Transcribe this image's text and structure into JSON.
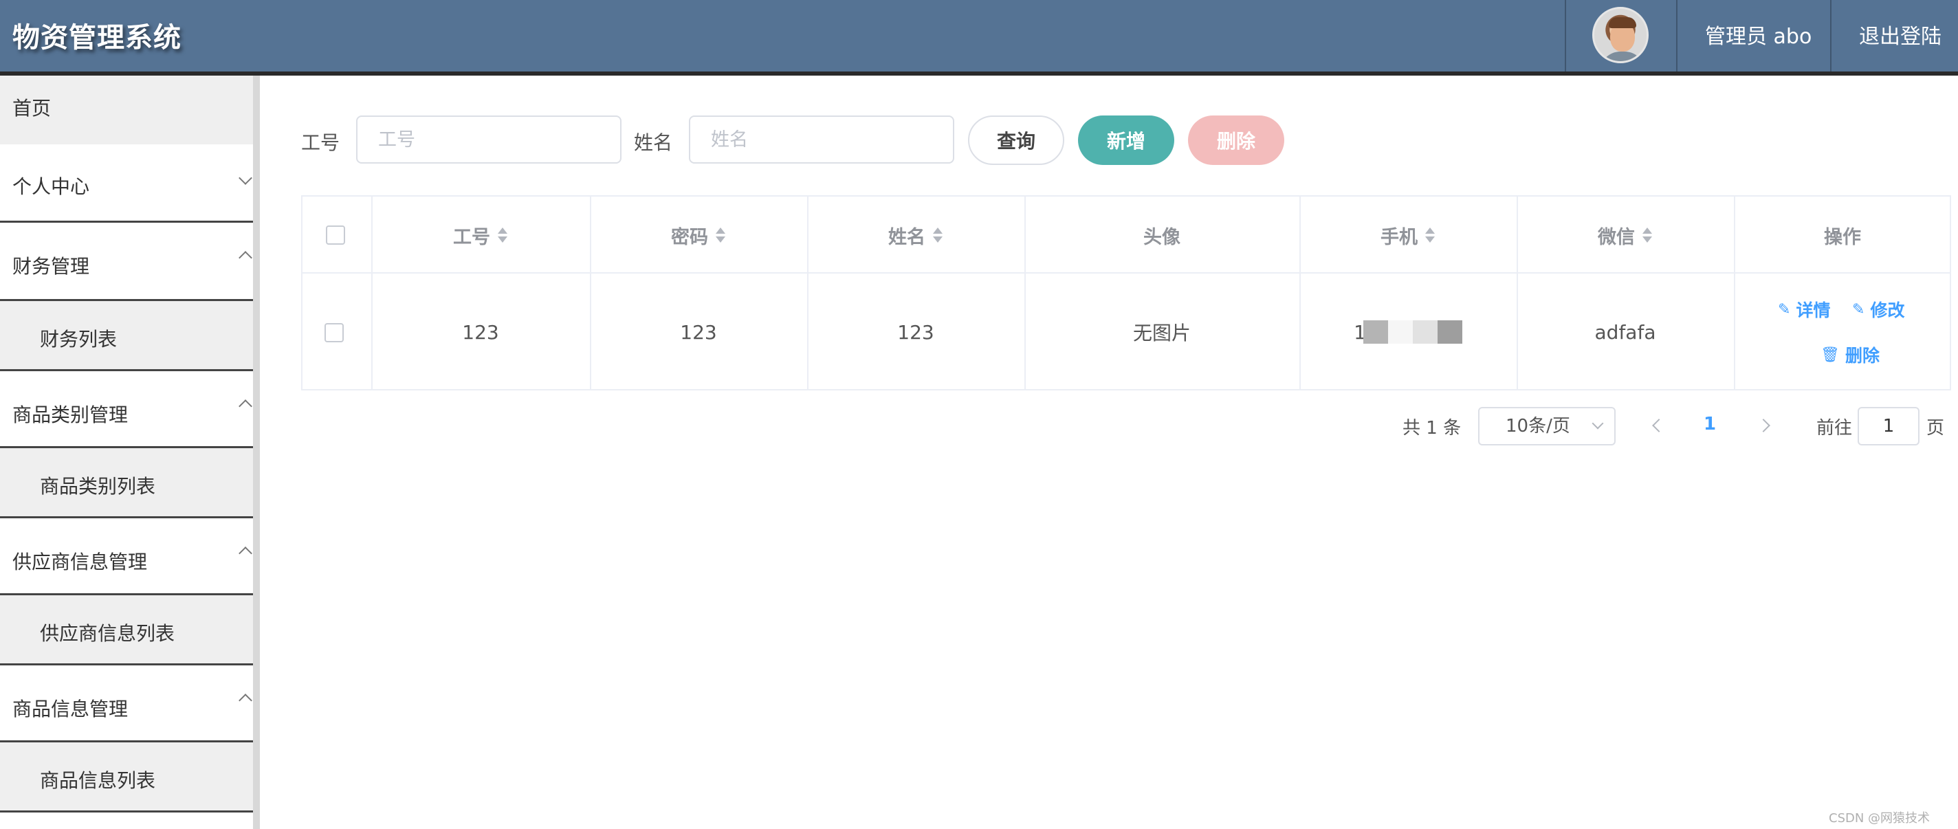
{
  "header": {
    "title": "物资管理系统",
    "user_label": "管理员 abo",
    "logout_label": "退出登陆"
  },
  "sidebar": {
    "items": [
      {
        "label": "首页"
      },
      {
        "label": "个人中心"
      },
      {
        "label": "财务管理"
      },
      {
        "label": "财务列表"
      },
      {
        "label": "商品类别管理"
      },
      {
        "label": "商品类别列表"
      },
      {
        "label": "供应商信息管理"
      },
      {
        "label": "供应商信息列表"
      },
      {
        "label": "商品信息管理"
      },
      {
        "label": "商品信息列表"
      }
    ]
  },
  "search": {
    "field1_label": "工号",
    "field1_placeholder": "工号",
    "field2_label": "姓名",
    "field2_placeholder": "姓名",
    "query_label": "查询",
    "add_label": "新增",
    "delete_label": "删除"
  },
  "table": {
    "columns": [
      "工号",
      "密码",
      "姓名",
      "头像",
      "手机",
      "微信",
      "操作"
    ],
    "rows": [
      {
        "id": "123",
        "password": "123",
        "name": "123",
        "avatar": "无图片",
        "phone_visible": "1",
        "wechat": "adfafa",
        "actions": {
          "detail": "详情",
          "edit": "修改",
          "delete": "删除"
        }
      }
    ]
  },
  "pagination": {
    "total_text": "共 1 条",
    "page_size": "10条/页",
    "current_page": "1",
    "goto_label": "前往",
    "goto_value": "1",
    "page_suffix": "页"
  },
  "watermark": "CSDN @网猿技术",
  "colors": {
    "header_bg": "#557394",
    "add_button": "#4fb2ad",
    "delete_button_disabled": "#f3bcbc",
    "link": "#409eff"
  }
}
